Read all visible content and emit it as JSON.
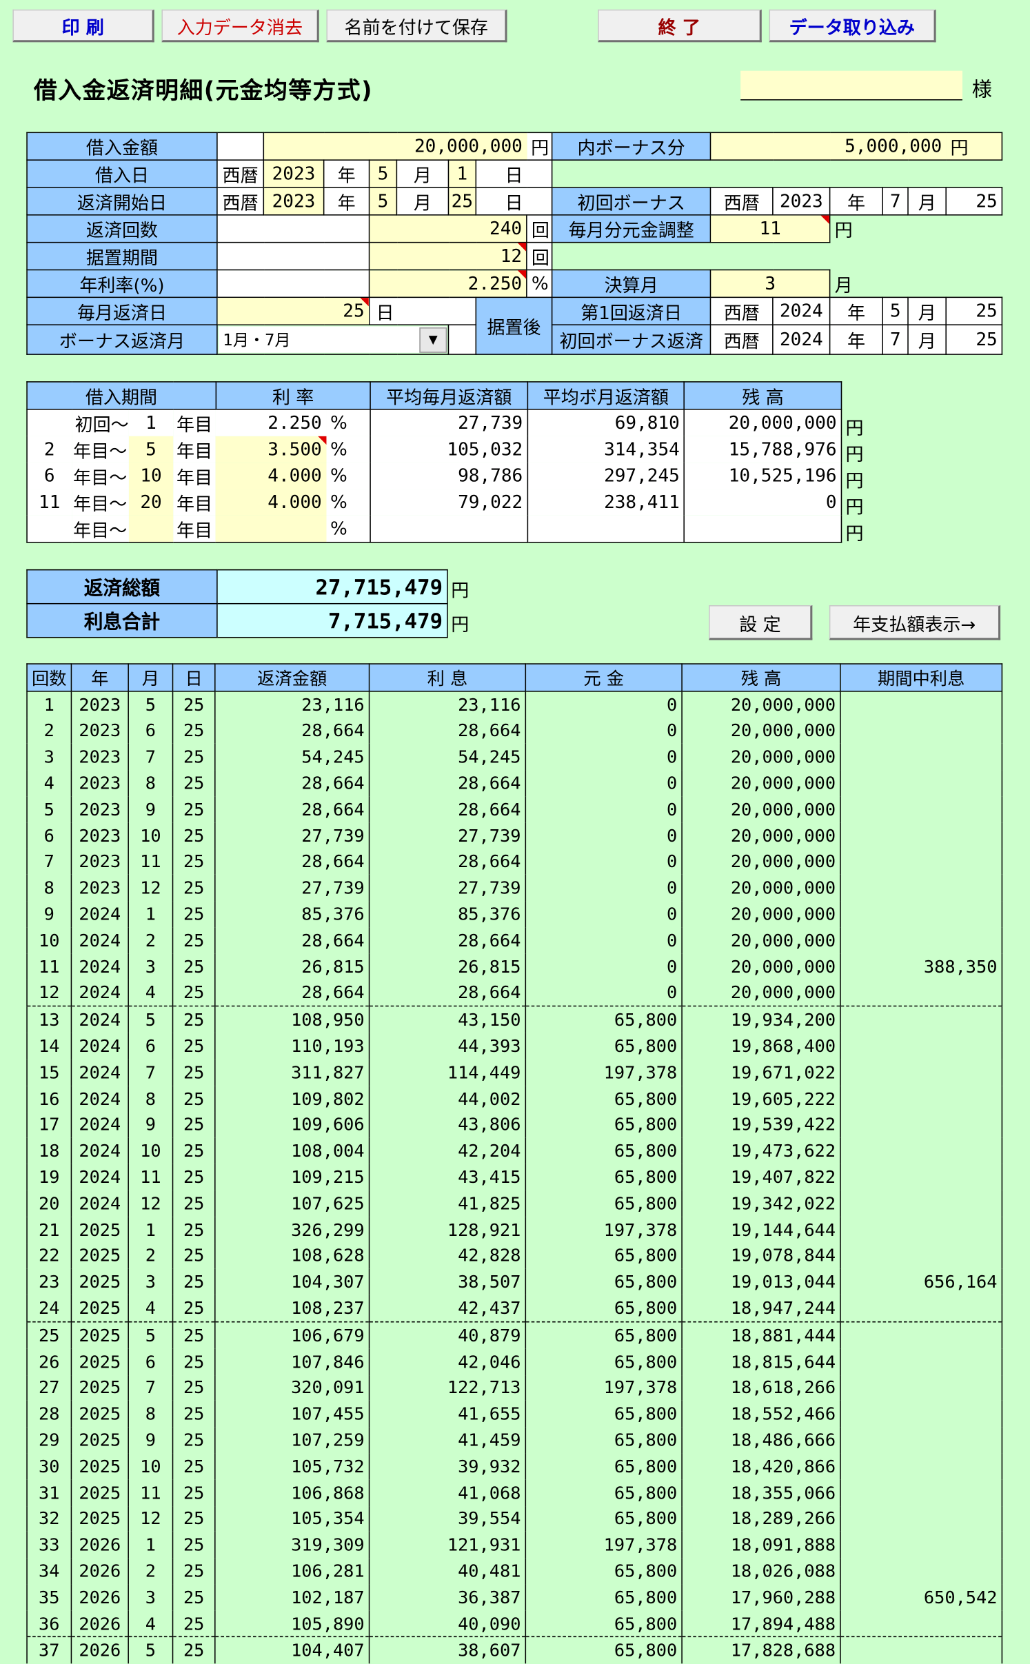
{
  "toolbar": {
    "print": "印 刷",
    "clear": "入力データ消去",
    "save_as": "名前を付けて保存",
    "exit": "終 了",
    "import": "データ取り込み"
  },
  "header": {
    "title": "借入金返済明細(元金均等方式)",
    "customer_name": "",
    "honorific": "様"
  },
  "colors": {
    "header_blue": "#99ccff",
    "input_yellow": "#ffffcc",
    "total_cyan": "#ccffff",
    "background": "#ccffcc",
    "print_text": "#0000cc",
    "clear_text": "#cc0000",
    "exit_text": "#990000"
  },
  "loan": {
    "amount_label": "借入金額",
    "amount": "20,000,000",
    "yen": "円",
    "bonus_part_label": "内ボーナス分",
    "bonus_part": "5,000,000",
    "borrow_date_label": "借入日",
    "era": "西暦",
    "borrow_year": "2023",
    "nen": "年",
    "borrow_month": "5",
    "tsuki": "月",
    "borrow_day": "1",
    "hi": "日",
    "start_label": "返済開始日",
    "start_year": "2023",
    "start_month": "5",
    "start_day": "25",
    "first_bonus_label": "初回ボーナス",
    "first_bonus_year": "2023",
    "first_bonus_month": "7",
    "first_bonus_day": "25",
    "count_label": "返済回数",
    "count": "240",
    "kai": "回",
    "adjust_label": "毎月分元金調整",
    "adjust": "11",
    "grace_label": "据置期間",
    "grace": "12",
    "rate_label": "年利率(%)",
    "rate": "2.250",
    "pct": "%",
    "settle_label": "決算月",
    "settle": "3",
    "monthly_day_label": "毎月返済日",
    "monthly_day": "25",
    "after_grace_label": "据置後",
    "first_repay_label": "第1回返済日",
    "first_repay_year": "2024",
    "first_repay_month": "5",
    "first_repay_day": "25",
    "bonus_month_label": "ボーナス返済月",
    "bonus_month": "1月・7月",
    "first_bonus_repay_label": "初回ボーナス返済",
    "first_bonus_repay_year": "2024",
    "first_bonus_repay_month": "7",
    "first_bonus_repay_day": "25"
  },
  "periods": {
    "headers": [
      "借入期間",
      "利 率",
      "平均毎月返済額",
      "平均ボ月返済額",
      "残 高"
    ],
    "first": "初回～",
    "kara": "年目～",
    "nenme": "年目",
    "rows": [
      {
        "start": "",
        "end": "1",
        "rate": "2.250",
        "monthly": "27,739",
        "bonus": "69,810",
        "balance": "20,000,000"
      },
      {
        "start": "2",
        "end": "5",
        "rate": "3.500",
        "monthly": "105,032",
        "bonus": "314,354",
        "balance": "15,788,976"
      },
      {
        "start": "6",
        "end": "10",
        "rate": "4.000",
        "monthly": "98,786",
        "bonus": "297,245",
        "balance": "10,525,196"
      },
      {
        "start": "11",
        "end": "20",
        "rate": "4.000",
        "monthly": "79,022",
        "bonus": "238,411",
        "balance": "0"
      },
      {
        "start": "",
        "end": "",
        "rate": "",
        "monthly": "",
        "bonus": "",
        "balance": ""
      }
    ]
  },
  "totals": {
    "total_label": "返済総額",
    "total": "27,715,479",
    "interest_label": "利息合計",
    "interest": "7,715,479"
  },
  "actions": {
    "settings": "設 定",
    "annual": "年支払額表示→"
  },
  "schedule": {
    "headers": [
      "回数",
      "年",
      "月",
      "日",
      "返済金額",
      "利 息",
      "元 金",
      "残 高",
      "期間中利息"
    ],
    "rows": [
      [
        "1",
        "2023",
        "5",
        "25",
        "23,116",
        "23,116",
        "0",
        "20,000,000",
        ""
      ],
      [
        "2",
        "2023",
        "6",
        "25",
        "28,664",
        "28,664",
        "0",
        "20,000,000",
        ""
      ],
      [
        "3",
        "2023",
        "7",
        "25",
        "54,245",
        "54,245",
        "0",
        "20,000,000",
        ""
      ],
      [
        "4",
        "2023",
        "8",
        "25",
        "28,664",
        "28,664",
        "0",
        "20,000,000",
        ""
      ],
      [
        "5",
        "2023",
        "9",
        "25",
        "28,664",
        "28,664",
        "0",
        "20,000,000",
        ""
      ],
      [
        "6",
        "2023",
        "10",
        "25",
        "27,739",
        "27,739",
        "0",
        "20,000,000",
        ""
      ],
      [
        "7",
        "2023",
        "11",
        "25",
        "28,664",
        "28,664",
        "0",
        "20,000,000",
        ""
      ],
      [
        "8",
        "2023",
        "12",
        "25",
        "27,739",
        "27,739",
        "0",
        "20,000,000",
        ""
      ],
      [
        "9",
        "2024",
        "1",
        "25",
        "85,376",
        "85,376",
        "0",
        "20,000,000",
        ""
      ],
      [
        "10",
        "2024",
        "2",
        "25",
        "28,664",
        "28,664",
        "0",
        "20,000,000",
        ""
      ],
      [
        "11",
        "2024",
        "3",
        "25",
        "26,815",
        "26,815",
        "0",
        "20,000,000",
        "388,350"
      ],
      [
        "12",
        "2024",
        "4",
        "25",
        "28,664",
        "28,664",
        "0",
        "20,000,000",
        ""
      ],
      [
        "13",
        "2024",
        "5",
        "25",
        "108,950",
        "43,150",
        "65,800",
        "19,934,200",
        ""
      ],
      [
        "14",
        "2024",
        "6",
        "25",
        "110,193",
        "44,393",
        "65,800",
        "19,868,400",
        ""
      ],
      [
        "15",
        "2024",
        "7",
        "25",
        "311,827",
        "114,449",
        "197,378",
        "19,671,022",
        ""
      ],
      [
        "16",
        "2024",
        "8",
        "25",
        "109,802",
        "44,002",
        "65,800",
        "19,605,222",
        ""
      ],
      [
        "17",
        "2024",
        "9",
        "25",
        "109,606",
        "43,806",
        "65,800",
        "19,539,422",
        ""
      ],
      [
        "18",
        "2024",
        "10",
        "25",
        "108,004",
        "42,204",
        "65,800",
        "19,473,622",
        ""
      ],
      [
        "19",
        "2024",
        "11",
        "25",
        "109,215",
        "43,415",
        "65,800",
        "19,407,822",
        ""
      ],
      [
        "20",
        "2024",
        "12",
        "25",
        "107,625",
        "41,825",
        "65,800",
        "19,342,022",
        ""
      ],
      [
        "21",
        "2025",
        "1",
        "25",
        "326,299",
        "128,921",
        "197,378",
        "19,144,644",
        ""
      ],
      [
        "22",
        "2025",
        "2",
        "25",
        "108,628",
        "42,828",
        "65,800",
        "19,078,844",
        ""
      ],
      [
        "23",
        "2025",
        "3",
        "25",
        "104,307",
        "38,507",
        "65,800",
        "19,013,044",
        "656,164"
      ],
      [
        "24",
        "2025",
        "4",
        "25",
        "108,237",
        "42,437",
        "65,800",
        "18,947,244",
        ""
      ],
      [
        "25",
        "2025",
        "5",
        "25",
        "106,679",
        "40,879",
        "65,800",
        "18,881,444",
        ""
      ],
      [
        "26",
        "2025",
        "6",
        "25",
        "107,846",
        "42,046",
        "65,800",
        "18,815,644",
        ""
      ],
      [
        "27",
        "2025",
        "7",
        "25",
        "320,091",
        "122,713",
        "197,378",
        "18,618,266",
        ""
      ],
      [
        "28",
        "2025",
        "8",
        "25",
        "107,455",
        "41,655",
        "65,800",
        "18,552,466",
        ""
      ],
      [
        "29",
        "2025",
        "9",
        "25",
        "107,259",
        "41,459",
        "65,800",
        "18,486,666",
        ""
      ],
      [
        "30",
        "2025",
        "10",
        "25",
        "105,732",
        "39,932",
        "65,800",
        "18,420,866",
        ""
      ],
      [
        "31",
        "2025",
        "11",
        "25",
        "106,868",
        "41,068",
        "65,800",
        "18,355,066",
        ""
      ],
      [
        "32",
        "2025",
        "12",
        "25",
        "105,354",
        "39,554",
        "65,800",
        "18,289,266",
        ""
      ],
      [
        "33",
        "2026",
        "1",
        "25",
        "319,309",
        "121,931",
        "197,378",
        "18,091,888",
        ""
      ],
      [
        "34",
        "2026",
        "2",
        "25",
        "106,281",
        "40,481",
        "65,800",
        "18,026,088",
        ""
      ],
      [
        "35",
        "2026",
        "3",
        "25",
        "102,187",
        "36,387",
        "65,800",
        "17,960,288",
        "650,542"
      ],
      [
        "36",
        "2026",
        "4",
        "25",
        "105,890",
        "40,090",
        "65,800",
        "17,894,488",
        ""
      ],
      [
        "37",
        "2026",
        "5",
        "25",
        "104,407",
        "38,607",
        "65,800",
        "17,828,688",
        ""
      ]
    ]
  }
}
